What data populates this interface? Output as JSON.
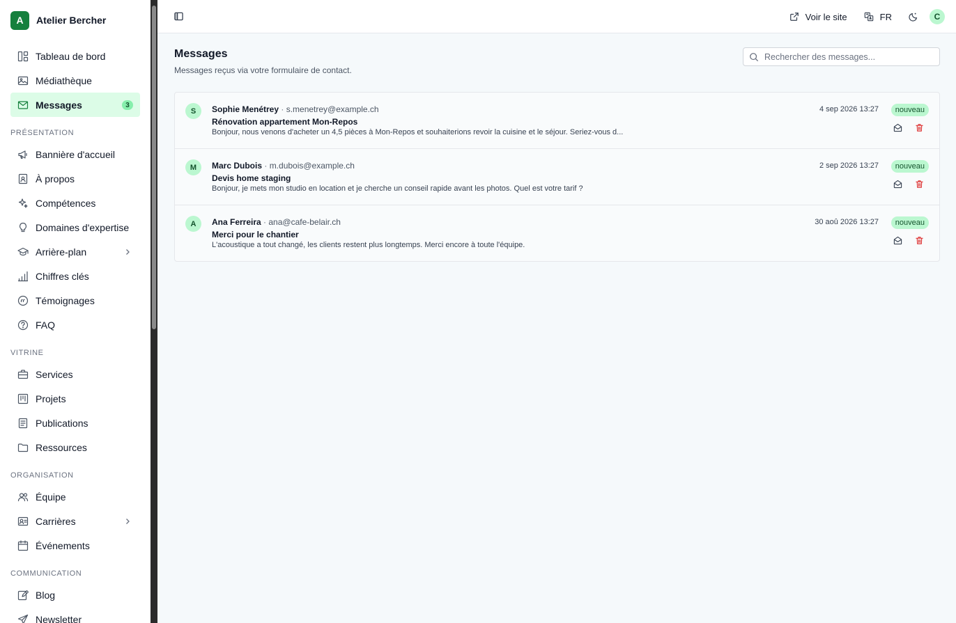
{
  "brand": {
    "logo_letter": "A",
    "name": "Atelier Bercher"
  },
  "nav": {
    "top": [
      {
        "label": "Tableau de bord",
        "icon": "dashboard-icon"
      },
      {
        "label": "Médiathèque",
        "icon": "image-icon"
      },
      {
        "label": "Messages",
        "icon": "mail-icon",
        "badge": "3",
        "active": true
      }
    ],
    "sections": [
      {
        "title": "PRÉSENTATION",
        "items": [
          {
            "label": "Bannière d'accueil",
            "icon": "megaphone-icon"
          },
          {
            "label": "À propos",
            "icon": "id-card-icon"
          },
          {
            "label": "Compétences",
            "icon": "sparkles-icon"
          },
          {
            "label": "Domaines d'expertise",
            "icon": "lightbulb-icon"
          },
          {
            "label": "Arrière-plan",
            "icon": "graduation-cap-icon",
            "chevron": true
          },
          {
            "label": "Chiffres clés",
            "icon": "bar-chart-icon"
          },
          {
            "label": "Témoignages",
            "icon": "quote-icon"
          },
          {
            "label": "FAQ",
            "icon": "help-circle-icon"
          }
        ]
      },
      {
        "title": "VITRINE",
        "items": [
          {
            "label": "Services",
            "icon": "briefcase-icon"
          },
          {
            "label": "Projets",
            "icon": "kanban-icon"
          },
          {
            "label": "Publications",
            "icon": "document-icon"
          },
          {
            "label": "Ressources",
            "icon": "folder-icon"
          }
        ]
      },
      {
        "title": "ORGANISATION",
        "items": [
          {
            "label": "Équipe",
            "icon": "users-icon"
          },
          {
            "label": "Carrières",
            "icon": "badge-icon",
            "chevron": true
          },
          {
            "label": "Événements",
            "icon": "calendar-icon"
          }
        ]
      },
      {
        "title": "COMMUNICATION",
        "items": [
          {
            "label": "Blog",
            "icon": "edit-icon"
          },
          {
            "label": "Newsletter",
            "icon": "send-icon"
          }
        ]
      }
    ]
  },
  "header": {
    "view_site": "Voir le site",
    "language": "FR",
    "user_initial": "C"
  },
  "page": {
    "title": "Messages",
    "subtitle": "Messages reçus via votre formulaire de contact.",
    "search_placeholder": "Rechercher des messages..."
  },
  "messages": [
    {
      "initial": "S",
      "name": "Sophie Menétrey",
      "email": "s.menetrey@example.ch",
      "subject": "Rénovation appartement Mon-Repos",
      "preview": "Bonjour, nous venons d'acheter un 4,5 pièces à Mon-Repos et souhaiterions revoir la cuisine et le séjour. Seriez-vous d...",
      "date": "4 sep 2026 13:27",
      "status": "nouveau"
    },
    {
      "initial": "M",
      "name": "Marc Dubois",
      "email": "m.dubois@example.ch",
      "subject": "Devis home staging",
      "preview": "Bonjour, je mets mon studio en location et je cherche un conseil rapide avant les photos. Quel est votre tarif ?",
      "date": "2 sep 2026 13:27",
      "status": "nouveau"
    },
    {
      "initial": "A",
      "name": "Ana Ferreira",
      "email": "ana@cafe-belair.ch",
      "subject": "Merci pour le chantier",
      "preview": "L'acoustique a tout changé, les clients restent plus longtemps. Merci encore à toute l'équipe.",
      "date": "30 aoû 2026 13:27",
      "status": "nouveau"
    }
  ],
  "colors": {
    "accent": "#15803d",
    "accent_soft": "#dcfce7",
    "danger": "#dc2626"
  }
}
